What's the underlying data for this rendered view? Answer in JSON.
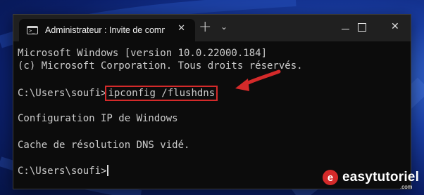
{
  "window": {
    "tab_title": "Administrateur : Invite de commandes",
    "tab_icon": "terminal-icon",
    "tab_icon_glyph": ">_",
    "tab_close": "✕",
    "new_tab": "+",
    "dropdown": "⌄",
    "close": "✕"
  },
  "console": {
    "line1": "Microsoft Windows [version 10.0.22000.184]",
    "line2": "(c) Microsoft Corporation. Tous droits réservés.",
    "prompt1": "C:\\Users\\soufi>",
    "command": "ipconfig /flushdns",
    "line4": "Configuration IP de Windows",
    "line5": "Cache de résolution DNS vidé.",
    "prompt2": "C:\\Users\\soufi>"
  },
  "watermark": {
    "logo_letter": "e",
    "text": "easytutoriel",
    "suffix": ".com"
  },
  "colors": {
    "highlight": "#d42a2a",
    "console_bg": "#0c0c0c",
    "console_text": "#cccccc"
  }
}
